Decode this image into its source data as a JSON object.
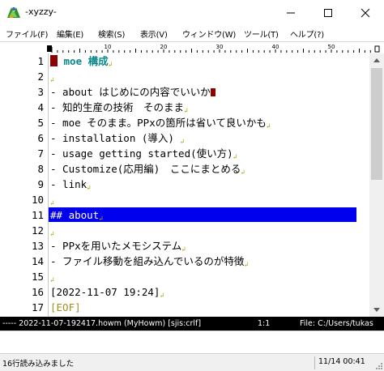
{
  "window": {
    "title": "-xyzzy-"
  },
  "menu": {
    "items": [
      "ファイル(F)",
      "編集(E)",
      "検索(S)",
      "表示(V)",
      "ウィンドウ(W)",
      "ツール(T)",
      "ヘルプ(?)"
    ]
  },
  "ruler": {
    "marks": [
      "10",
      "20",
      "30",
      "40",
      "50"
    ]
  },
  "editor": {
    "lines": [
      {
        "num": "1",
        "text": "moe 構成"
      },
      {
        "num": "2",
        "text": ""
      },
      {
        "num": "3",
        "text": "- about はじめにの内容でいいか"
      },
      {
        "num": "4",
        "text": "- 知的生産の技術　そのまま"
      },
      {
        "num": "5",
        "text": "- moe そのまま。PPxの箇所は省いて良いかも"
      },
      {
        "num": "6",
        "text": "- installation (導入) "
      },
      {
        "num": "7",
        "text": "- usage getting started(使い方)"
      },
      {
        "num": "8",
        "text": "- Customize(応用編)　ここにまとめる"
      },
      {
        "num": "9",
        "text": "- link"
      },
      {
        "num": "10",
        "text": ""
      },
      {
        "num": "11",
        "text": "## about"
      },
      {
        "num": "12",
        "text": ""
      },
      {
        "num": "13",
        "text": "- PPxを用いたメモシステム"
      },
      {
        "num": "14",
        "text": "- ファイル移動を組み込んでいるのが特徴"
      },
      {
        "num": "15",
        "text": ""
      },
      {
        "num": "16",
        "text": "[2022-11-07 19:24]"
      },
      {
        "num": "17",
        "text": "[EOF]"
      }
    ]
  },
  "modeline": {
    "left": "----- 2022-11-07-192417.howm (MyHowm) [sjis:crlf]",
    "position": "1:1",
    "file": "File: C:/Users/tukas"
  },
  "status": {
    "message": "16行読み込みました",
    "datetime": "11/14 00:41"
  },
  "colors": {
    "heading": "#0a8a8a",
    "selection": "#0000ee",
    "cursor": "#8b0000",
    "newline_mark": "#b0a000"
  }
}
